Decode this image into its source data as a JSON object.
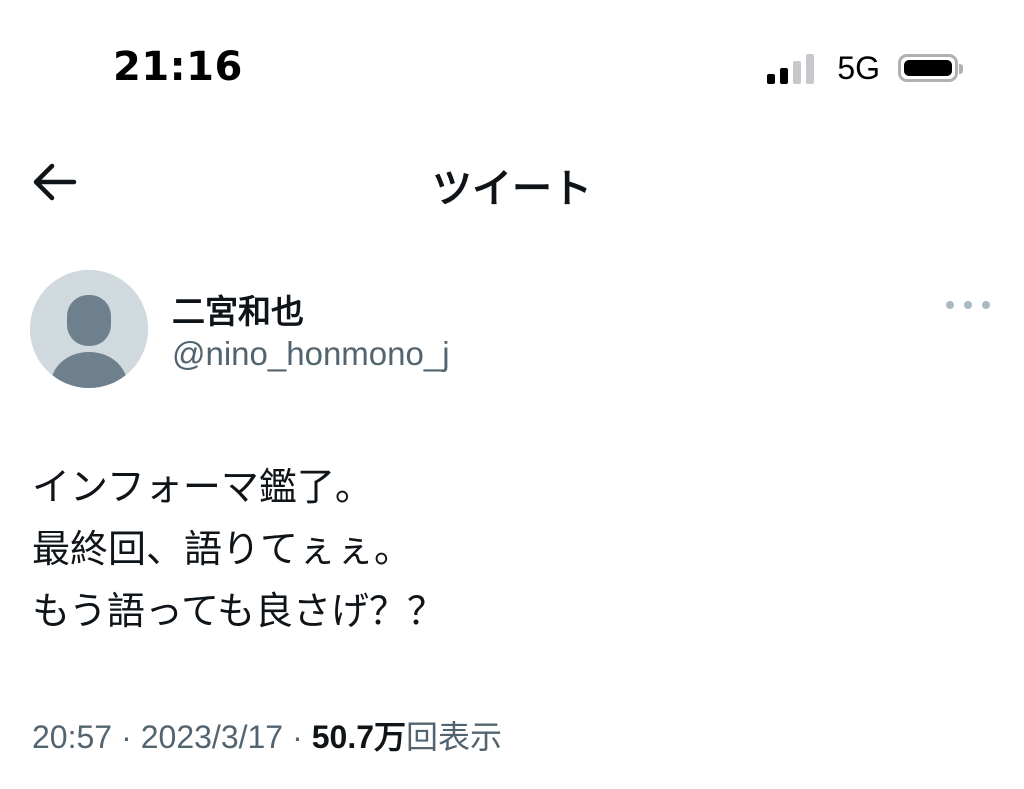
{
  "status_bar": {
    "time": "21:16",
    "network": "5G",
    "signal_bars_active": 2,
    "signal_bars_total": 4,
    "battery_level": 1.0
  },
  "header": {
    "title": "ツイート",
    "back_icon": "arrow-left-icon"
  },
  "tweet": {
    "author": {
      "display_name": "二宮和也",
      "handle": "@nino_honmono_j",
      "avatar": "default-avatar-icon"
    },
    "more_icon": "more-horizontal-icon",
    "lines": [
      "インフォーマ鑑了。",
      "最終回、語りてぇぇ。",
      "もう語っても良さげ？？"
    ],
    "time": "20:57",
    "separator": "·",
    "date": "2023/3/17",
    "views_count": "50.7万",
    "views_label": "回表示"
  },
  "colors": {
    "text_primary": "#0f1419",
    "text_secondary": "#536471",
    "avatar_bg": "#cfd9de",
    "avatar_fg": "#6e7f8d",
    "icon_muted": "#aab8c2"
  }
}
